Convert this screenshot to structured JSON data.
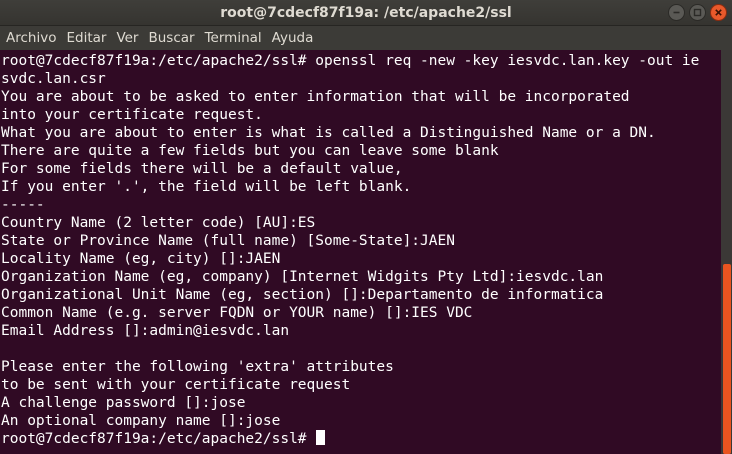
{
  "window": {
    "title": "root@7cdecf87f19a: /etc/apache2/ssl"
  },
  "menu": {
    "items": [
      "Archivo",
      "Editar",
      "Ver",
      "Buscar",
      "Terminal",
      "Ayuda"
    ]
  },
  "terminal": {
    "lines": [
      "root@7cdecf87f19a:/etc/apache2/ssl# openssl req -new -key iesvdc.lan.key -out ie",
      "svdc.lan.csr",
      "You are about to be asked to enter information that will be incorporated",
      "into your certificate request.",
      "What you are about to enter is what is called a Distinguished Name or a DN.",
      "There are quite a few fields but you can leave some blank",
      "For some fields there will be a default value,",
      "If you enter '.', the field will be left blank.",
      "-----",
      "Country Name (2 letter code) [AU]:ES",
      "State or Province Name (full name) [Some-State]:JAEN",
      "Locality Name (eg, city) []:JAEN",
      "Organization Name (eg, company) [Internet Widgits Pty Ltd]:iesvdc.lan",
      "Organizational Unit Name (eg, section) []:Departamento de informatica",
      "Common Name (e.g. server FQDN or YOUR name) []:IES VDC",
      "Email Address []:admin@iesvdc.lan",
      "",
      "Please enter the following 'extra' attributes",
      "to be sent with your certificate request",
      "A challenge password []:jose",
      "An optional company name []:jose",
      "root@7cdecf87f19a:/etc/apache2/ssl# "
    ]
  },
  "colors": {
    "terminal_background": "#300a24",
    "terminal_text": "#ffffff",
    "scrollbar_thumb": "#e95420",
    "close_button": "#e9592b"
  },
  "icons": {
    "minimize": "minimize-icon",
    "maximize": "maximize-icon",
    "close": "close-icon"
  }
}
